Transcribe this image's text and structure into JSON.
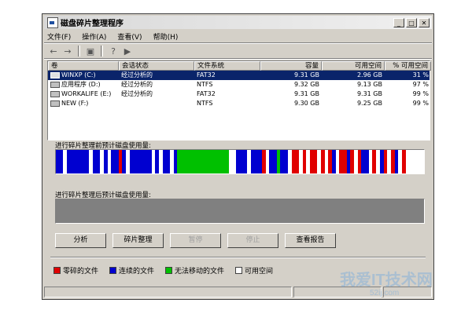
{
  "window": {
    "title": "磁盘碎片整理程序"
  },
  "menu": [
    "文件(F)",
    "操作(A)",
    "查看(V)",
    "帮助(H)"
  ],
  "toolbar": {
    "icons": [
      "back-arrow-icon",
      "forward-arrow-icon",
      "properties-icon",
      "help-icon",
      "play-icon"
    ]
  },
  "columns": [
    "卷",
    "会话状态",
    "文件系统",
    "容量",
    "可用空间",
    "% 可用空间"
  ],
  "volumes": [
    {
      "name": "WINXP (C:)",
      "status": "经过分析的",
      "fs": "FAT32",
      "capacity": "9.31 GB",
      "free": "2.96 GB",
      "pct": "31 %"
    },
    {
      "name": "应用程序 (D:)",
      "status": "经过分析的",
      "fs": "NTFS",
      "capacity": "9.32 GB",
      "free": "9.13 GB",
      "pct": "97 %"
    },
    {
      "name": "WORKALIFE (E:)",
      "status": "经过分析的",
      "fs": "FAT32",
      "capacity": "9.31 GB",
      "free": "9.31 GB",
      "pct": "99 %"
    },
    {
      "name": "NEW (F:)",
      "status": "",
      "fs": "NTFS",
      "capacity": "9.30 GB",
      "free": "9.25 GB",
      "pct": "99 %"
    }
  ],
  "labels": {
    "before": "进行碎片整理前预计磁盘使用量:",
    "after": "进行碎片整理后预计磁盘使用量:"
  },
  "buttons": {
    "analyze": "分析",
    "defrag": "碎片整理",
    "pause": "暂停",
    "stop": "停止",
    "report": "查看报告"
  },
  "legend": [
    {
      "label": "零碎的文件",
      "color": "#e00000"
    },
    {
      "label": "连续的文件",
      "color": "#0000d0"
    },
    {
      "label": "无法移动的文件",
      "color": "#00c000"
    },
    {
      "label": "可用空间",
      "color": "#ffffff"
    }
  ],
  "watermark": {
    "text": "我爱IT技术网",
    "url": "52ij.com"
  },
  "colors": {
    "selection": "#0a246a",
    "face": "#d4d0c8",
    "after_bar": "#808080"
  }
}
